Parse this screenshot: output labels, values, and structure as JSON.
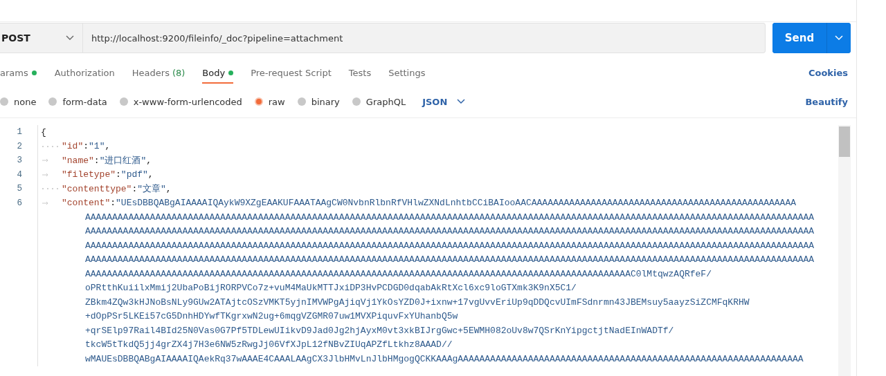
{
  "request": {
    "method": "POST",
    "url": "http://localhost:9200/fileinfo/_doc?pipeline=attachment",
    "send": "Send"
  },
  "tabs": [
    {
      "label": "arams",
      "dot": true,
      "selected": false
    },
    {
      "label": "Authorization",
      "dot": false,
      "selected": false
    },
    {
      "label": "Headers",
      "count": "(8)",
      "dot": false,
      "selected": false
    },
    {
      "label": "Body",
      "dot": true,
      "selected": true
    },
    {
      "label": "Pre-request Script",
      "dot": false,
      "selected": false
    },
    {
      "label": "Tests",
      "dot": false,
      "selected": false
    },
    {
      "label": "Settings",
      "dot": false,
      "selected": false
    }
  ],
  "cookies": "Cookies",
  "body_types": [
    {
      "label": "none",
      "selected": false
    },
    {
      "label": "form-data",
      "selected": false
    },
    {
      "label": "x-www-form-urlencoded",
      "selected": false
    },
    {
      "label": "raw",
      "selected": true
    },
    {
      "label": "binary",
      "selected": false
    },
    {
      "label": "GraphQL",
      "selected": false
    }
  ],
  "format": "JSON",
  "beautify": "Beautify",
  "editor": {
    "lines": [
      {
        "number": "1",
        "kind": "plain",
        "parts": [
          {
            "kind": "punct",
            "text": "{"
          }
        ]
      },
      {
        "number": "2",
        "kind": "space",
        "parts": [
          {
            "kind": "key",
            "text": "\"id\""
          },
          {
            "kind": "punct",
            "text": ":"
          },
          {
            "kind": "string",
            "text": "\"1\""
          },
          {
            "kind": "punct",
            "text": ","
          }
        ]
      },
      {
        "number": "3",
        "kind": "tab",
        "parts": [
          {
            "kind": "key",
            "text": "\"name\""
          },
          {
            "kind": "punct",
            "text": ":"
          },
          {
            "kind": "string",
            "text": "\"进口红酒\""
          },
          {
            "kind": "punct",
            "text": ","
          }
        ]
      },
      {
        "number": "4",
        "kind": "tab",
        "parts": [
          {
            "kind": "key",
            "text": "\"filetype\""
          },
          {
            "kind": "punct",
            "text": ":"
          },
          {
            "kind": "string",
            "text": "\"pdf\""
          },
          {
            "kind": "punct",
            "text": ","
          }
        ]
      },
      {
        "number": "5",
        "kind": "space",
        "parts": [
          {
            "kind": "key",
            "text": "\"contenttype\""
          },
          {
            "kind": "punct",
            "text": ":"
          },
          {
            "kind": "string",
            "text": "\"文章\""
          },
          {
            "kind": "punct",
            "text": ","
          }
        ]
      },
      {
        "number": "6",
        "kind": "tab",
        "parts": [
          {
            "kind": "key",
            "text": "\"content\""
          },
          {
            "kind": "punct",
            "text": ":"
          },
          {
            "kind": "string",
            "text": "\"UEsDBBQABgAIAAAAIQAykW9XZgEAAKUFAAATAAgCW0NvbnRlbnRfVHlwZXNdLnhtbCCiBAIooAACAAAAAAAAAAAAAAAAAAAAAAAAAAAAAAAAAAAAAAAAAAAAAAAAA"
          }
        ]
      },
      {
        "kind": "wrap",
        "parts": [
          {
            "kind": "string",
            "text": "AAAAAAAAAAAAAAAAAAAAAAAAAAAAAAAAAAAAAAAAAAAAAAAAAAAAAAAAAAAAAAAAAAAAAAAAAAAAAAAAAAAAAAAAAAAAAAAAAAAAAAAAAAAAAAAAAAAAAAAAAAAAAAAAAAAAAAA"
          }
        ]
      },
      {
        "kind": "wrap",
        "parts": [
          {
            "kind": "string",
            "text": "AAAAAAAAAAAAAAAAAAAAAAAAAAAAAAAAAAAAAAAAAAAAAAAAAAAAAAAAAAAAAAAAAAAAAAAAAAAAAAAAAAAAAAAAAAAAAAAAAAAAAAAAAAAAAAAAAAAAAAAAAAAAAAAAAAAAAAA"
          }
        ]
      },
      {
        "kind": "wrap",
        "parts": [
          {
            "kind": "string",
            "text": "AAAAAAAAAAAAAAAAAAAAAAAAAAAAAAAAAAAAAAAAAAAAAAAAAAAAAAAAAAAAAAAAAAAAAAAAAAAAAAAAAAAAAAAAAAAAAAAAAAAAAAAAAAAAAAAAAAAAAAAAAAAAAAAAAAAAAAA"
          }
        ]
      },
      {
        "kind": "wrap",
        "parts": [
          {
            "kind": "string",
            "text": "AAAAAAAAAAAAAAAAAAAAAAAAAAAAAAAAAAAAAAAAAAAAAAAAAAAAAAAAAAAAAAAAAAAAAAAAAAAAAAAAAAAAAAAAAAAAAAAAAAAAAAAAAAAAAAAAAAAAAAAAAAAAAAAAAAAAAAA"
          }
        ]
      },
      {
        "kind": "wrap",
        "parts": [
          {
            "kind": "string",
            "text": "AAAAAAAAAAAAAAAAAAAAAAAAAAAAAAAAAAAAAAAAAAAAAAAAAAAAAAAAAAAAAAAAAAAAAAAAAAAAAAAAAAAAAAAAAAAAAAAAAAAAAC0lMtqwzAQRfeF/"
          }
        ]
      },
      {
        "kind": "wrap",
        "parts": [
          {
            "kind": "string",
            "text": "oPRtthKuiilxMmij2UbaPoBijRORPVCo7z+vuM4MaUkMTTJxiDP3HvPCDGD0dqabAkRtXcl6xc9loGTXmk3K9nX5C1/"
          }
        ]
      },
      {
        "kind": "wrap",
        "parts": [
          {
            "kind": "string",
            "text": "ZBkm4ZQw3kHJNoBsNLy9GUw2ATAjtcOSzVMKT5yjnIMVWPgAjiqVj1YkOsYZD0J+ixnw+17vgUvvEriUp9qDDQcvUImFSdnrmn43JBEMsuy5aayzSiZCMFqKRHW"
          }
        ]
      },
      {
        "kind": "wrap",
        "parts": [
          {
            "kind": "string",
            "text": "+dOpPSr5LKEi57cG5DnhHDYwfTKgrxwN2ug+6mqgVZGMR07uw1MVXPiquvFxYUhanbQ5w"
          }
        ]
      },
      {
        "kind": "wrap",
        "parts": [
          {
            "kind": "string",
            "text": "+qrSElp97Rail4BId25N0Vas0G7Pf5TDLewUIikvD9Jad0Jg2hjAyxM0vt3xkBIJrgGwc+5EWMH082oUv8w7QSrKnYipgctjtNadEInWADTf/"
          }
        ]
      },
      {
        "kind": "wrap",
        "parts": [
          {
            "kind": "string",
            "text": "tkcW5tTkdQ5jj4grZX4j7H3e6NW5zRwgJj06VfXJpL12fNBvZIUqAPZfLtkhz8AAAD//"
          }
        ]
      },
      {
        "kind": "wrap",
        "parts": [
          {
            "kind": "string",
            "text": "wMAUEsDBBQABgAIAAAAIQAekRq37wAAAE4CAAALAAgCX3JlbHMvLnJlbHMgogQCKKAAAgAAAAAAAAAAAAAAAAAAAAAAAAAAAAAAAAAAAAAAAAAAAAAAAAAAAAAAAAAAAAAAAA"
          }
        ]
      }
    ]
  }
}
